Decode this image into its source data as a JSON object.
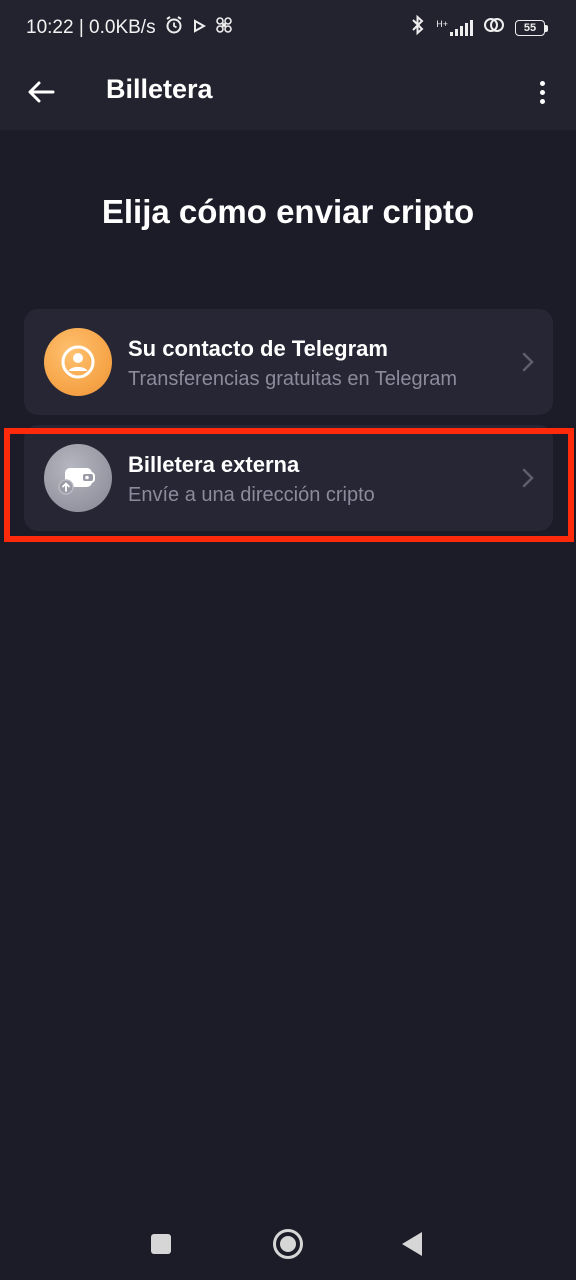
{
  "status_bar": {
    "time_speed": "10:22 | 0.0KB/s",
    "network_label": "H+",
    "battery_level": "55",
    "icons": [
      "alarm-icon",
      "play-icon",
      "pinwheel-icon",
      "bluetooth-icon",
      "signal-icon",
      "hotspot-icon",
      "battery-icon"
    ]
  },
  "app_bar": {
    "title": "Billetera",
    "icons": [
      "back-arrow-icon",
      "more-vert-icon"
    ]
  },
  "heading": "Elija cómo enviar cripto",
  "options": [
    {
      "title": "Su contacto de Telegram",
      "subtitle": "Transferencias gratuitas en Telegram",
      "icon": "contact-icon",
      "icon_color": "#f7a64a"
    },
    {
      "title": "Billetera externa",
      "subtitle": "Envíe a una dirección cripto",
      "icon": "wallet-send-icon",
      "icon_color": "#9a9aa6",
      "highlighted": true
    }
  ],
  "colors": {
    "background": "#1c1c28",
    "card": "#262634",
    "highlight": "#ff2a0c",
    "subtitle": "#8b8b9c"
  },
  "nav_bar": {
    "icons": [
      "recents-icon",
      "home-icon",
      "back-icon"
    ]
  }
}
